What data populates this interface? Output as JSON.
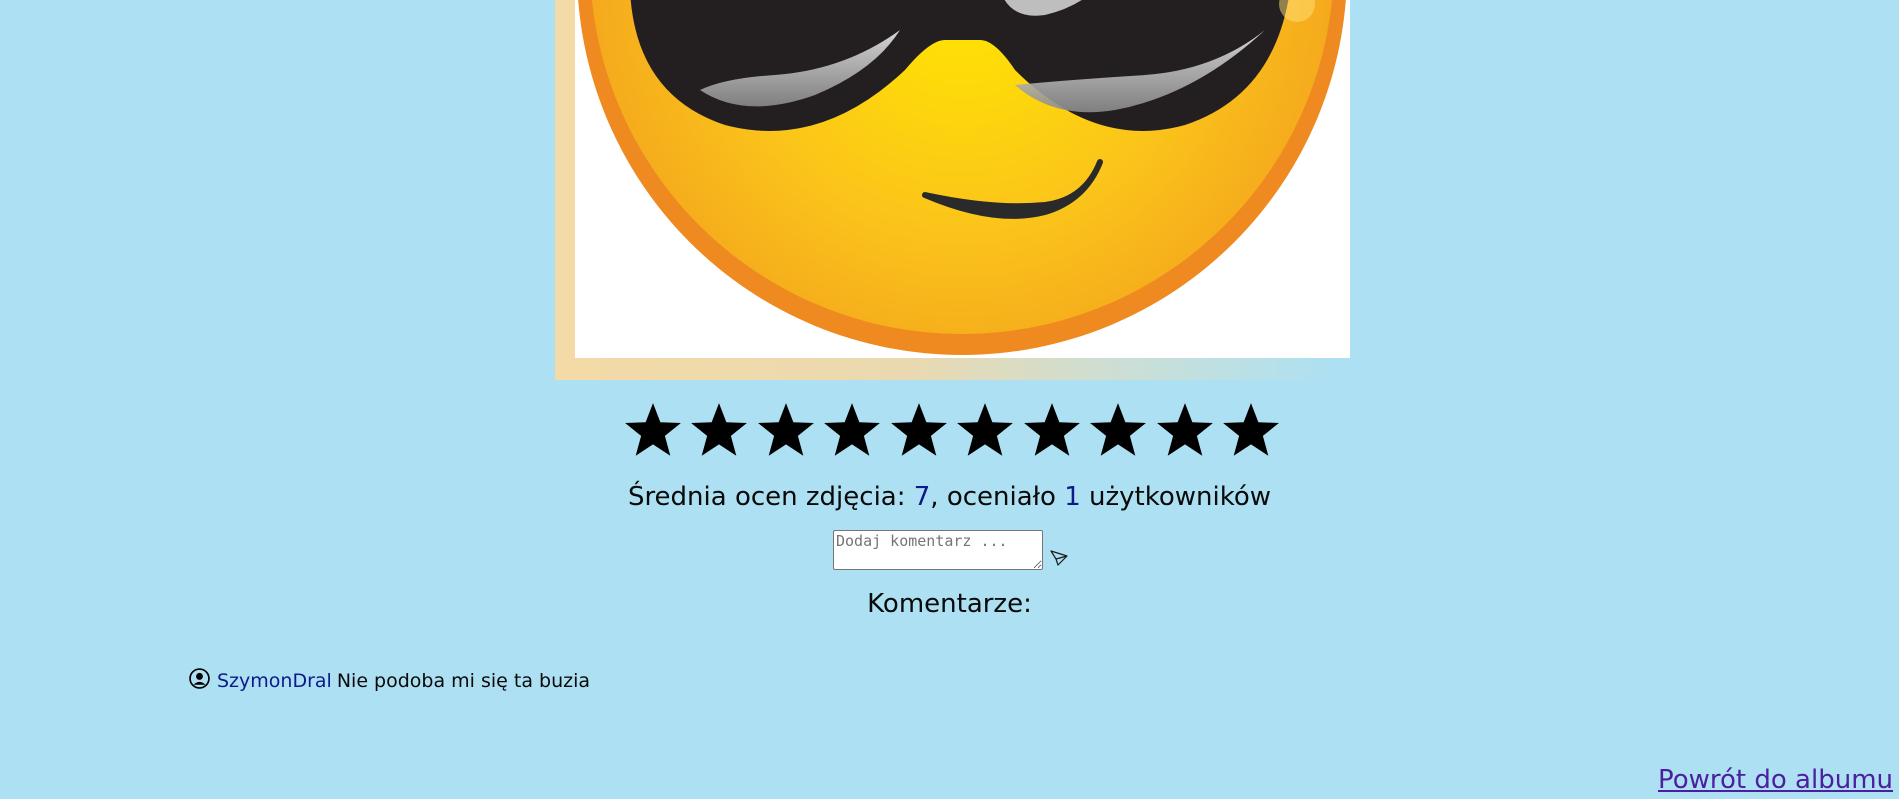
{
  "photo": {
    "description_icon": "sunglasses-emoji-image"
  },
  "rating": {
    "stars_total": 10,
    "star_icon": "star-icon",
    "star_color": "#000000",
    "prefix": "Średnia ocen zdjęcia: ",
    "average": "7",
    "middle": ", oceniało ",
    "count": "1",
    "suffix": " użytkowników",
    "number_color": "#0c1a8a"
  },
  "comment_form": {
    "placeholder": "Dodaj komentarz ...",
    "value": "",
    "send_icon": "send-icon"
  },
  "comments": {
    "heading": "Komentarze:",
    "items": [
      {
        "avatar_icon": "user-circle-icon",
        "author": "SzymonDral",
        "text": "Nie podoba mi się ta buzia"
      }
    ]
  },
  "navigation": {
    "back_link": "Powrót do albumu"
  },
  "colors": {
    "background": "#ADE0F2",
    "link": "#4B1FA0",
    "author": "#0c1a8a"
  }
}
